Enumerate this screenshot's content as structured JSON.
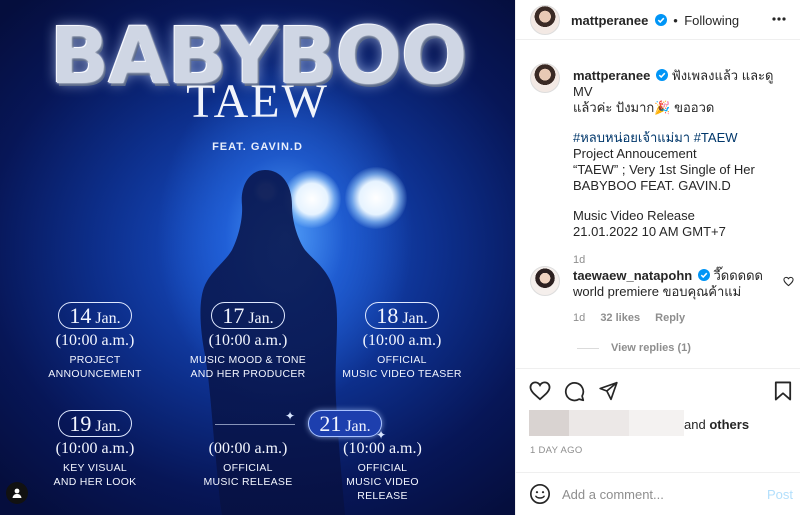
{
  "poster": {
    "title": "BABYBOO",
    "subtitle": "TAEW",
    "feat": "FEAT. GAVIN.D",
    "schedule": [
      {
        "day": "14",
        "month": "Jan.",
        "time": "(10:00 a.m.)",
        "line1": "PROJECT",
        "line2": "ANNOUNCEMENT",
        "active": false
      },
      {
        "day": "17",
        "month": "Jan.",
        "time": "(10:00 a.m.)",
        "line1": "MUSIC MOOD & TONE",
        "line2": "AND HER PRODUCER",
        "active": false
      },
      {
        "day": "18",
        "month": "Jan.",
        "time": "(10:00 a.m.)",
        "line1": "OFFICIAL",
        "line2": "MUSIC VIDEO TEASER",
        "active": false
      },
      {
        "day": "19",
        "month": "Jan.",
        "time": "(10:00 a.m.)",
        "line1": "KEY VISUAL",
        "line2": "AND HER LOOK",
        "active": false
      },
      {
        "day": "",
        "month": "",
        "time": "(00:00 a.m.)",
        "line1": "OFFICIAL",
        "line2": "MUSIC RELEASE",
        "active": false
      },
      {
        "day": "21",
        "month": "Jan.",
        "time": "(10:00 a.m.)",
        "line1": "OFFICIAL",
        "line2": "MUSIC VIDEO RELEASE",
        "active": true
      }
    ]
  },
  "header": {
    "username": "mattperanee",
    "separator": "•",
    "follow_label": "Following",
    "more_icon": "more-horizontal-icon"
  },
  "caption": {
    "username": "mattperanee",
    "line1": "ฟังเพลงแล้ว และดู MV",
    "line2": "แล้วค่ะ ปังมาก",
    "emoji": "🎉",
    "line2_end": " ขออวด",
    "hashtags": "#หลบหน่อยเจ้าแม่มา #TAEW",
    "p1": "Project Annoucement",
    "p2": "“TAEW” ; Very 1st Single of Her",
    "p3": "BABYBOO FEAT. GAVIN.D",
    "p4": "Music Video Release",
    "p5": "21.01.2022 10 AM GMT+7",
    "age": "1d"
  },
  "comment": {
    "username": "taewaew_natapohn",
    "text1": "วี๊ดดดดด",
    "text2": "world premiere ขอบคุณค้าแม่",
    "age": "1d",
    "likes": "32 likes",
    "reply_label": "Reply",
    "view_replies": "View replies (1)"
  },
  "likes": {
    "and_text": "and ",
    "others": "others",
    "date": "1 DAY AGO"
  },
  "add_comment": {
    "placeholder": "Add a comment...",
    "post_label": "Post"
  },
  "colors": {
    "verified": "#0095f6",
    "link": "#00376b",
    "muted": "#8e8e8e",
    "post_disabled": "#b2dffc"
  }
}
